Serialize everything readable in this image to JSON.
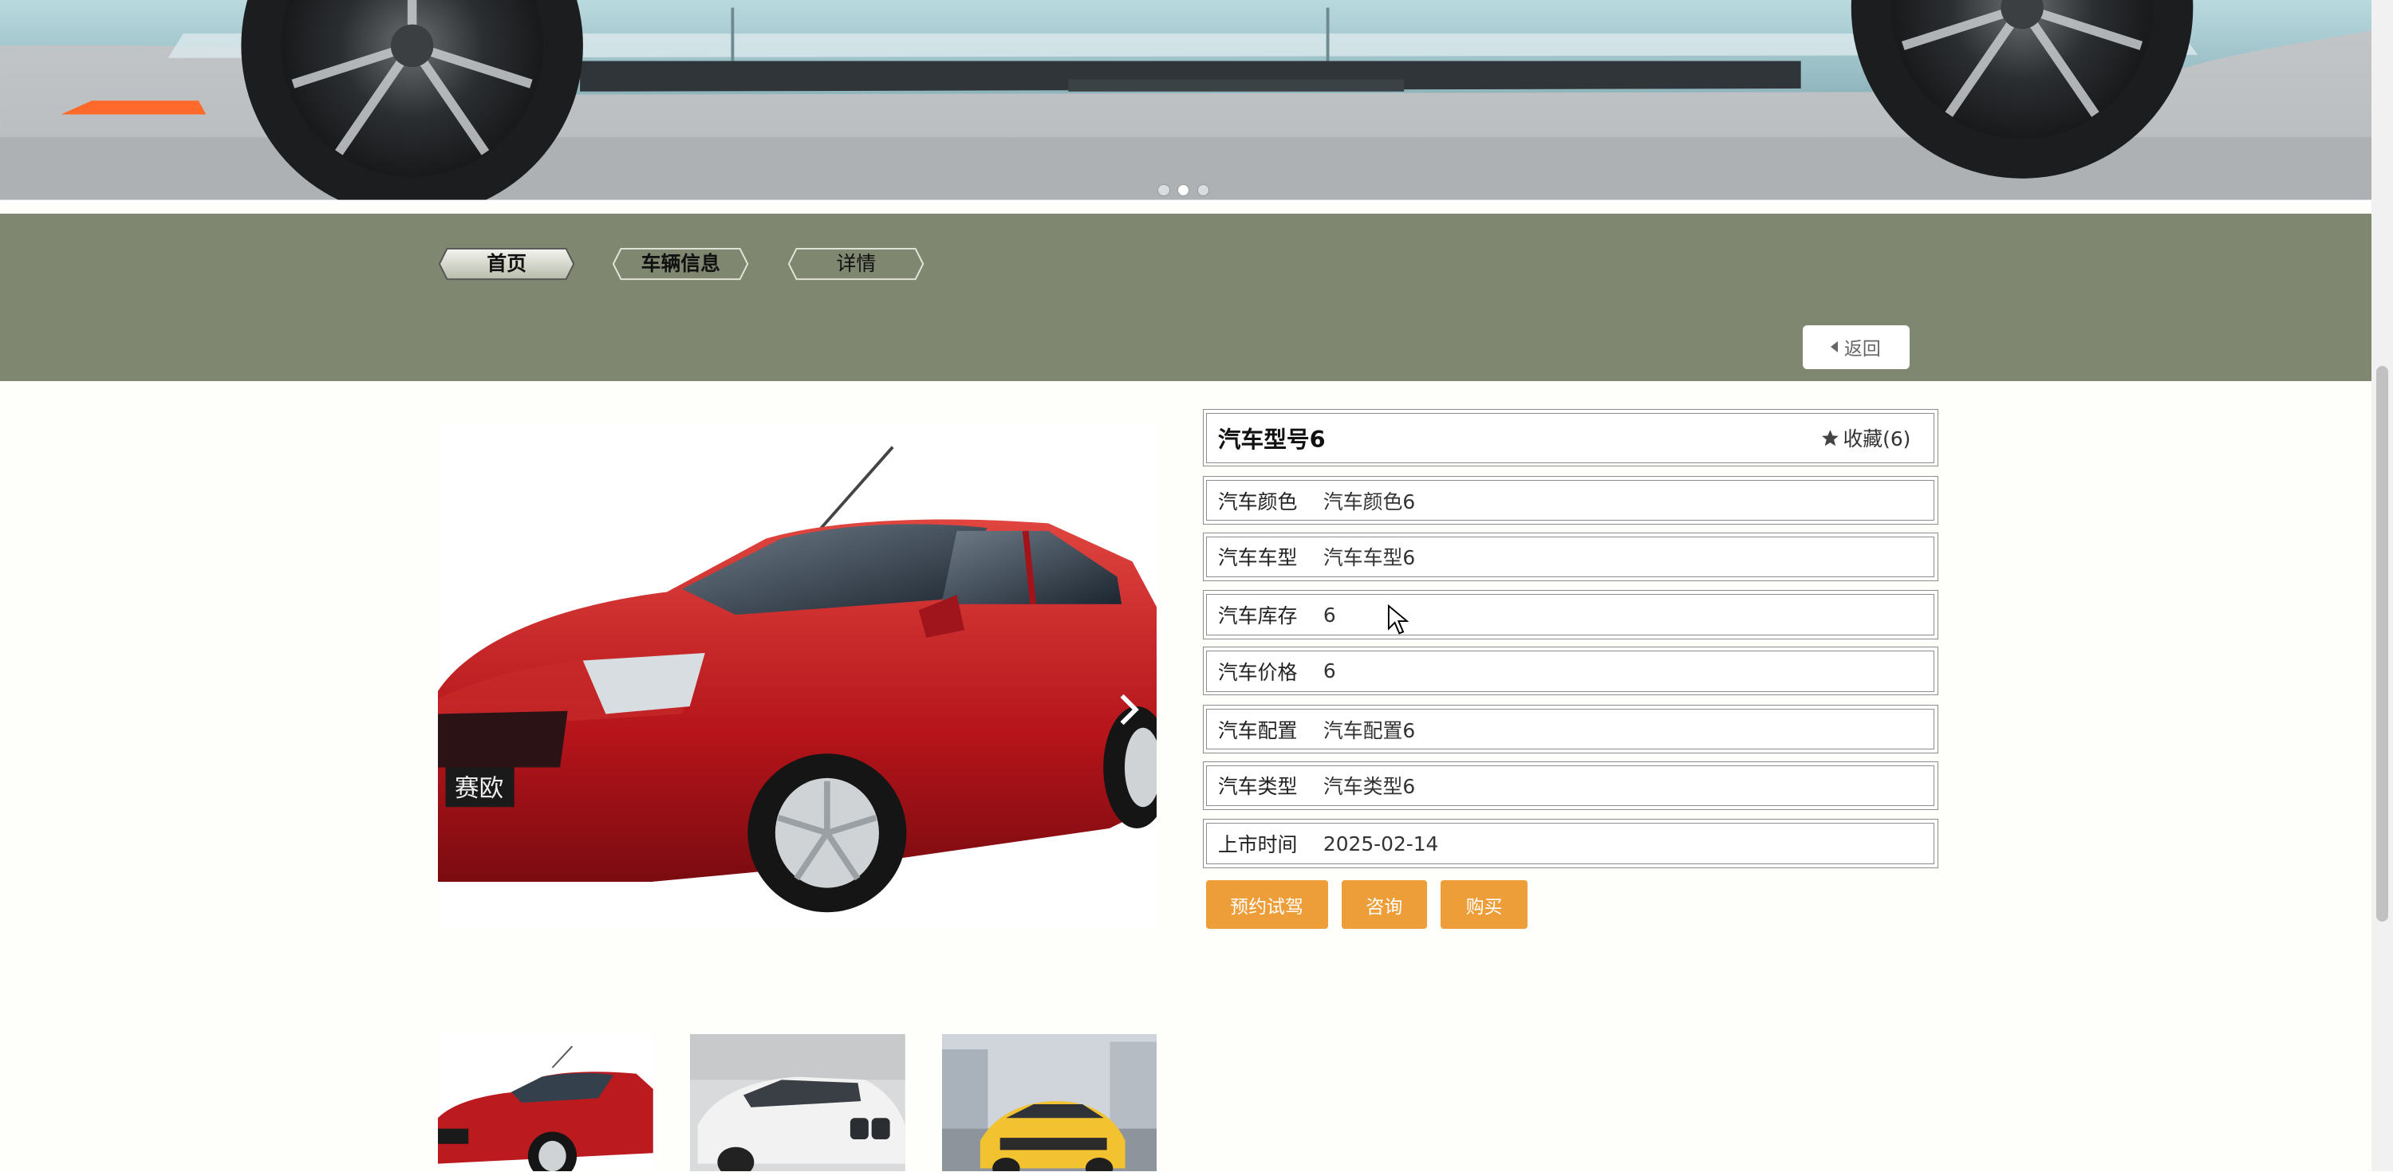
{
  "banner": {
    "dots": 3,
    "active_dot": 2
  },
  "nav": {
    "tabs": [
      {
        "label": "首页"
      },
      {
        "label": "车辆信息"
      },
      {
        "label": "详情"
      }
    ],
    "back_label": "返回"
  },
  "detail": {
    "title": "汽车型号6",
    "favorite_label": "收藏(6)",
    "fields": [
      {
        "label": "汽车颜色",
        "value": "汽车颜色6"
      },
      {
        "label": "汽车车型",
        "value": "汽车车型6"
      },
      {
        "label": "汽车库存",
        "value": "6"
      },
      {
        "label": "汽车价格",
        "value": "6"
      },
      {
        "label": "汽车配置",
        "value": "汽车配置6"
      },
      {
        "label": "汽车类型",
        "value": "汽车类型6"
      },
      {
        "label": "上市时间",
        "value": "2025-02-14"
      }
    ],
    "actions": {
      "test_drive": "预约试驾",
      "consult": "咨询",
      "buy": "购买"
    }
  },
  "main_image": {
    "badge_text": "赛欧"
  },
  "thumbnails": [
    {
      "name": "red-sedan"
    },
    {
      "name": "white-suv"
    },
    {
      "name": "yellow-suv"
    }
  ],
  "colors": {
    "nav_band": "#808771",
    "action_button": "#ed9e39",
    "page_bg": "#fefefb"
  }
}
